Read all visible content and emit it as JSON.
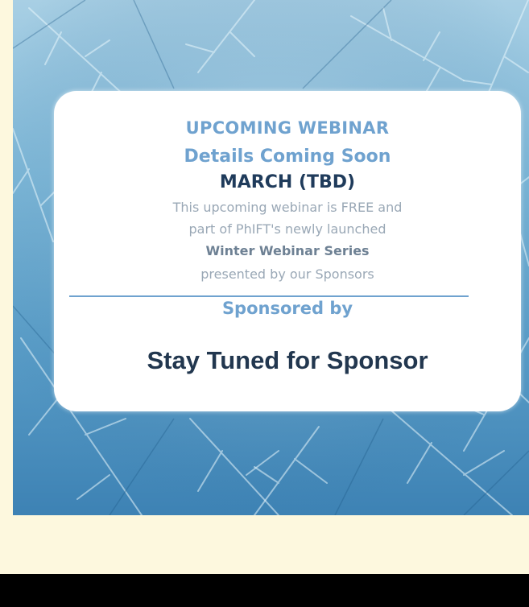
{
  "webinar": {
    "heading": "UPCOMING WEBINAR",
    "subheading": "Details Coming Soon",
    "date": "MARCH (TBD)",
    "description_line1": "This upcoming webinar is FREE and",
    "description_line2": "part of PhIFT's newly launched",
    "series_name": "Winter Webinar Series",
    "description_line4": "presented by our Sponsors",
    "sponsored_label": "Sponsored by",
    "sponsor_name": "Stay Tuned for Sponsor"
  },
  "colors": {
    "accent_blue": "#6fa2cf",
    "dark_navy": "#1f3b5b",
    "page_background": "#fdf8de",
    "bottom_bar": "#000000"
  }
}
